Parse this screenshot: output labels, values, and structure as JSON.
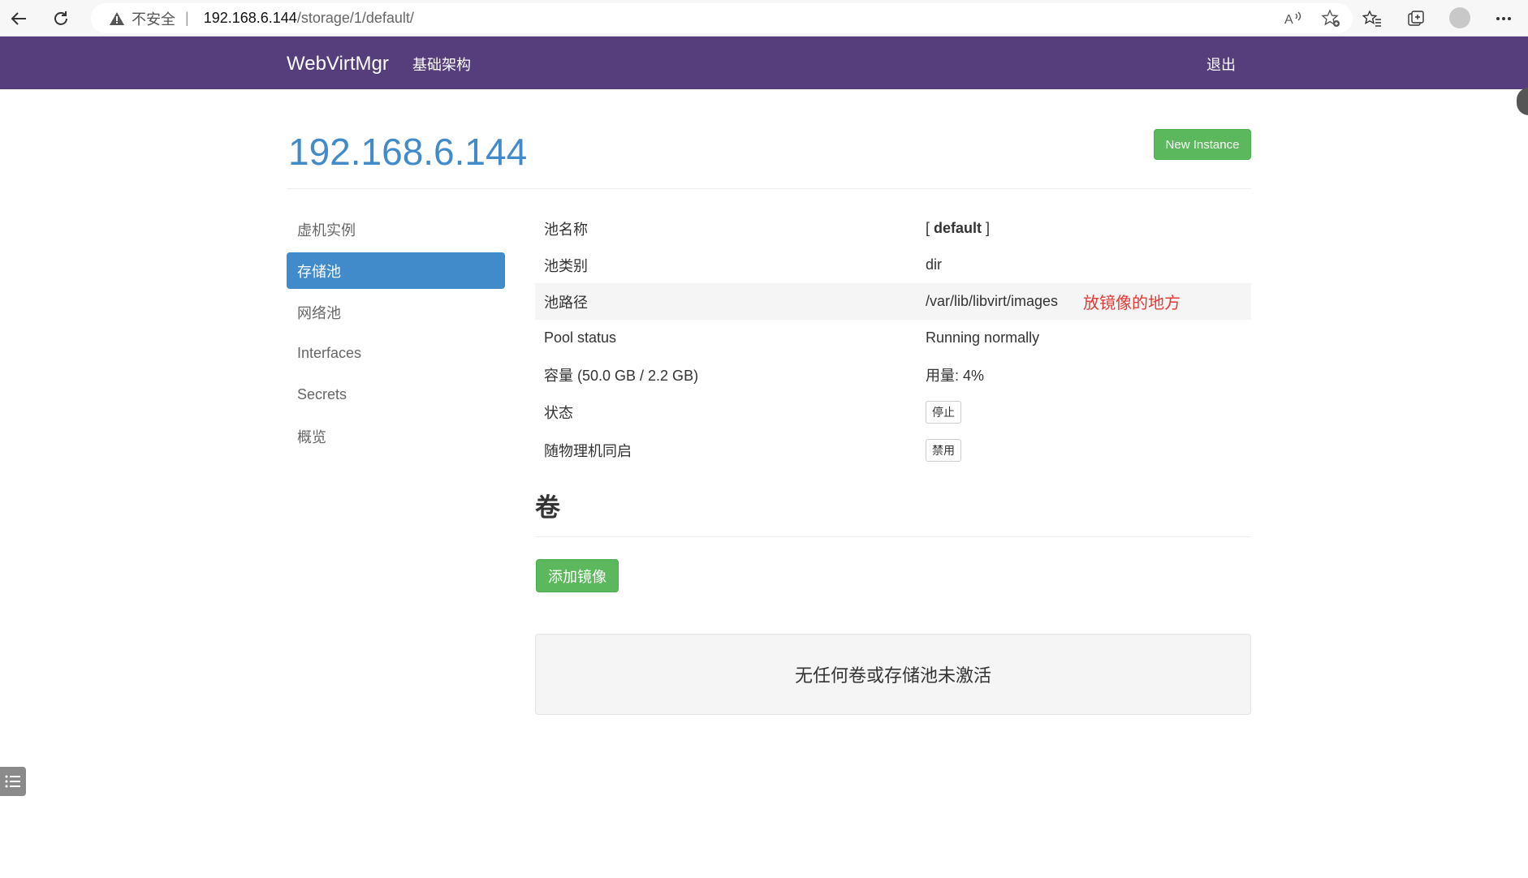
{
  "browser": {
    "security_label": "不安全",
    "separator": "|",
    "url_host": "192.168.6.144",
    "url_path": "/storage/1/default/"
  },
  "navbar": {
    "brand": "WebVirtMgr",
    "infrastructure": "基础架构",
    "logout": "退出"
  },
  "header": {
    "title": "192.168.6.144",
    "new_instance": "New Instance"
  },
  "sidebar": {
    "items": [
      {
        "label": "虚机实例"
      },
      {
        "label": "存储池",
        "active": true
      },
      {
        "label": "网络池"
      },
      {
        "label": "Interfaces"
      },
      {
        "label": "Secrets"
      },
      {
        "label": "概览"
      }
    ]
  },
  "pool": {
    "name_label": "池名称",
    "name_open": "[ ",
    "name_value": "default",
    "name_close": " ]",
    "type_label": "池类别",
    "type_value": "dir",
    "path_label": "池路径",
    "path_value": "/var/lib/libvirt/images",
    "path_note": "放镜像的地方",
    "status_label": "Pool status",
    "status_value": "Running normally",
    "capacity_label": "容量 (50.0 GB / 2.2 GB)",
    "usage_value": "用量: 4%",
    "state_label": "状态",
    "state_button": "停止",
    "autostart_label": "随物理机同启",
    "autostart_button": "禁用"
  },
  "volumes": {
    "title": "卷",
    "add_button": "添加镜像",
    "empty_message": "无任何卷或存储池未激活"
  }
}
